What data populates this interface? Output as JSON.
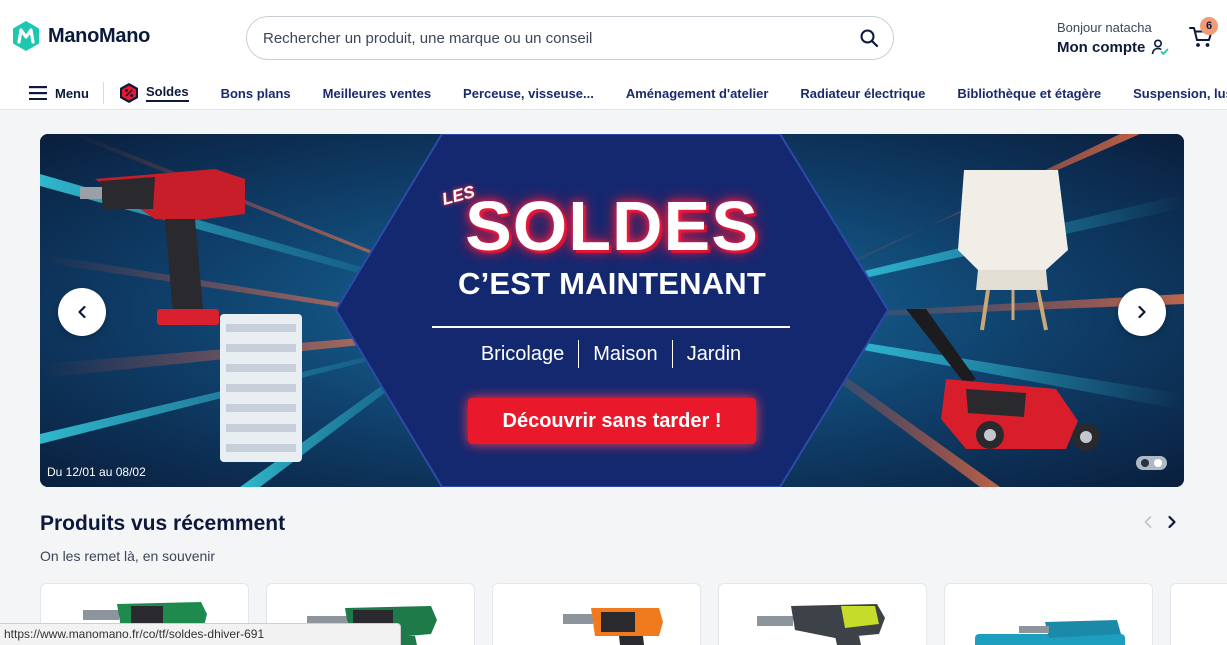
{
  "colors": {
    "brand": "#0c193a",
    "accent": "#1ec8b0",
    "sale_red": "#e9192b",
    "badge": "#f29b76"
  },
  "header": {
    "logo_text": "ManoMano",
    "search": {
      "placeholder": "Rechercher un produit, une marque ou un conseil",
      "value": ""
    },
    "greeting": "Bonjour natacha",
    "account_label": "Mon compte",
    "cart_count": "6"
  },
  "nav": {
    "menu_label": "Menu",
    "soldes_label": "Soldes",
    "links": [
      "Bons plans",
      "Meilleures ventes",
      "Perceuse, visseuse...",
      "Aménagement d'atelier",
      "Radiateur électrique",
      "Bibliothèque et étagère",
      "Suspension, lustre et acce"
    ]
  },
  "banner": {
    "les": "LES",
    "title": "SOLDES",
    "subtitle": "C’EST MAINTENANT",
    "categories": [
      "Bricolage",
      "Maison",
      "Jardin"
    ],
    "cta": "Découvrir sans tarder !",
    "dates": "Du 12/01 au 08/02",
    "slide_count": 2,
    "active_slide": 1
  },
  "recent": {
    "title": "Produits vus récemment",
    "subtitle": "On les remet là, en souvenir",
    "items": [
      "drill-green",
      "drill-green-2",
      "drill-orange",
      "drill-ryobi",
      "drill-makita-case"
    ]
  },
  "status_url": "https://www.manomano.fr/co/tf/soldes-dhiver-691"
}
